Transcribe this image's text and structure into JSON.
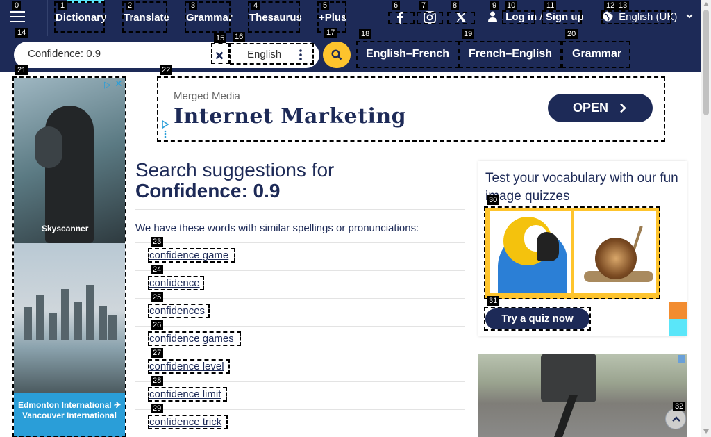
{
  "nav": {
    "items": [
      {
        "label": "Dictionary"
      },
      {
        "label": "Translate"
      },
      {
        "label": "Grammar"
      },
      {
        "label": "Thesaurus"
      },
      {
        "label": "+Plus"
      }
    ],
    "social_icons": [
      "facebook-icon",
      "instagram-icon",
      "x-icon"
    ],
    "login_label": "Log in",
    "separator": "/",
    "signup_label": "Sign up",
    "site_language": "English (UK)"
  },
  "search": {
    "value": "Confidence: 0.9",
    "language": "English",
    "tabs": [
      "English–French",
      "French–English",
      "Grammar"
    ]
  },
  "left_ad": {
    "brand": "Skyscanner",
    "caption": "Edmonton International ✈ Vancouver International"
  },
  "banner_ad": {
    "brand": "Merged Media",
    "headline": "Internet Marketing",
    "cta": "OPEN"
  },
  "main": {
    "title_prefix": "Search suggestions for",
    "title_query": "Confidence: 0.9",
    "intro": "We have these words with similar spellings or pronunciations:",
    "suggestions": [
      "confidence game",
      "confidence",
      "confidences",
      "confidence games",
      "confidence level",
      "confidence limit",
      "confidence trick"
    ]
  },
  "quiz": {
    "title": "Test your vocabulary with our fun image quizzes",
    "button": "Try a quiz now"
  },
  "marks": [
    "0",
    "1",
    "2",
    "3",
    "4",
    "5",
    "6",
    "7",
    "8",
    "9",
    "10",
    "11",
    "12",
    "13",
    "14",
    "15",
    "16",
    "17",
    "18",
    "19",
    "20",
    "21",
    "22",
    "23",
    "24",
    "25",
    "26",
    "27",
    "28",
    "29",
    "30",
    "31",
    "32"
  ],
  "colors": {
    "brand_navy": "#1d2a57",
    "accent_yellow": "#fec42d",
    "accent_cyan": "#5ae6f9",
    "accent_orange": "#f28c30"
  }
}
